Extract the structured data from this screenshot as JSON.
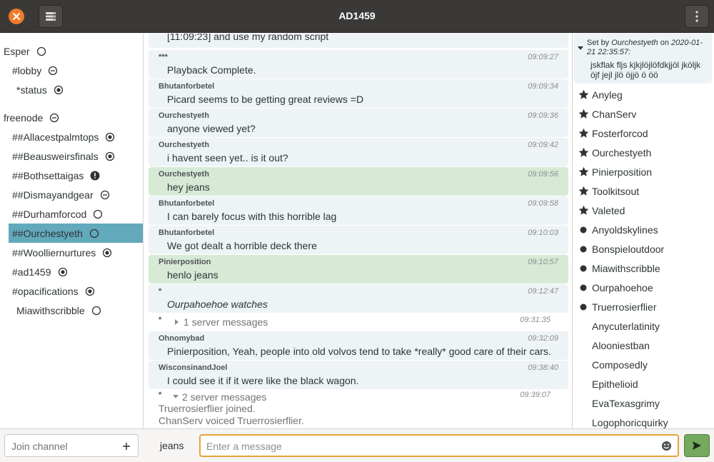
{
  "window": {
    "title": "AD1459"
  },
  "sidebar": {
    "items": [
      {
        "label": "Esper"
      },
      {
        "label": "#lobby"
      },
      {
        "label": "*status"
      },
      {
        "label": "freenode"
      },
      {
        "label": "##Allacestpalmtops"
      },
      {
        "label": "##Beausweirsfinals"
      },
      {
        "label": "##Bothsettaigas"
      },
      {
        "label": "##Dismayandgear"
      },
      {
        "label": "##Durhamforcod"
      },
      {
        "label": "##Ourchestyeth"
      },
      {
        "label": "##Woolliernurtures"
      },
      {
        "label": "#ad1459"
      },
      {
        "label": "#opacifications"
      },
      {
        "label": "Miawithscribble"
      }
    ],
    "join_placeholder": "Join channel"
  },
  "chat": {
    "partial_message": "[11:09:23] and use my random script",
    "messages": [
      {
        "nick": "***",
        "time": "09:09:27",
        "text": "Playback Complete."
      },
      {
        "nick": "Bhutanforbetel",
        "time": "09:09:34",
        "text": " Picard seems to be getting great reviews =D"
      },
      {
        "nick": "Ourchestyeth",
        "time": "09:09:36",
        "text": "anyone viewed yet?"
      },
      {
        "nick": "Ourchestyeth",
        "time": "09:09:42",
        "text": "i havent seen yet.. is it out?"
      },
      {
        "nick": "Ourchestyeth",
        "time": "09:09:56",
        "text": "hey jeans"
      },
      {
        "nick": "Bhutanforbetel",
        "time": "09:09:58",
        "text": "I can barely focus with this horrible lag"
      },
      {
        "nick": "Bhutanforbetel",
        "time": "09:10:03",
        "text": "We got dealt a horrible deck there"
      },
      {
        "nick": "Pinierposition",
        "time": "09:10:57",
        "text": "henlo jeans"
      },
      {
        "nick": "*",
        "time": "09:12:47",
        "text": "Ourpahoehoe watches"
      },
      {
        "nick": "Ohnomybad",
        "time": "09:32:09",
        "text": "Pinierposition, Yeah, people into old volvos tend to take *really* good care of their cars."
      },
      {
        "nick": "WisconsinandJoel",
        "time": "09:38:40",
        "text": "I could see it if it were like the black wagon."
      }
    ],
    "server_groups": [
      {
        "nick": "*",
        "label": "1 server messages",
        "time": "09:31:35"
      },
      {
        "nick": "*",
        "label": "2 server messages",
        "time": "09:39:07",
        "lines": [
          "Truerrosierflier joined.",
          "ChanServ voiced Truerrosierflier."
        ]
      }
    ]
  },
  "topic": {
    "set_by_prefix": "Set by",
    "set_by_nick": "Ourchestyeth",
    "set_by_on": "on",
    "set_by_date": "2020-01-21 22:35:57:",
    "text": "jskflak fljs kjkjlöjlöfdkjjöl jköljk öjf jejl jlö öjjö ö öö"
  },
  "users": [
    {
      "name": "Anyleg",
      "icon": "star-icon"
    },
    {
      "name": "ChanServ",
      "icon": "star-icon"
    },
    {
      "name": "Fosterforcod",
      "icon": "star-icon"
    },
    {
      "name": "Ourchestyeth",
      "icon": "star-icon"
    },
    {
      "name": "Pinierposition",
      "icon": "star-icon"
    },
    {
      "name": "Toolkitsout",
      "icon": "star-icon"
    },
    {
      "name": "Valeted",
      "icon": "star-icon"
    },
    {
      "name": "Anyoldskylines",
      "icon": "dot-icon"
    },
    {
      "name": "Bonspieloutdoor",
      "icon": "dot-icon"
    },
    {
      "name": "Miawithscribble",
      "icon": "dot-icon"
    },
    {
      "name": "Ourpahoehoe",
      "icon": "dot-icon"
    },
    {
      "name": "Truerrosierflier",
      "icon": "dot-icon"
    },
    {
      "name": "Anycuterlatinity",
      "icon": ""
    },
    {
      "name": "Alooniestban",
      "icon": ""
    },
    {
      "name": "Composedly",
      "icon": ""
    },
    {
      "name": "Epithelioid",
      "icon": ""
    },
    {
      "name": "EvaTexasgrimy",
      "icon": ""
    },
    {
      "name": "Logophoricquirky",
      "icon": ""
    }
  ],
  "composer": {
    "nick": "jeans",
    "placeholder": "Enter a message"
  },
  "colors": {
    "titlebar": "#3a3937",
    "close": "#f07b2a",
    "selected_channel": "#62aabb",
    "highlight_message": "#d7ead6",
    "message_bg": "#eef3f6",
    "input_focus": "#e8a33e",
    "send_button": "#75a95e"
  }
}
